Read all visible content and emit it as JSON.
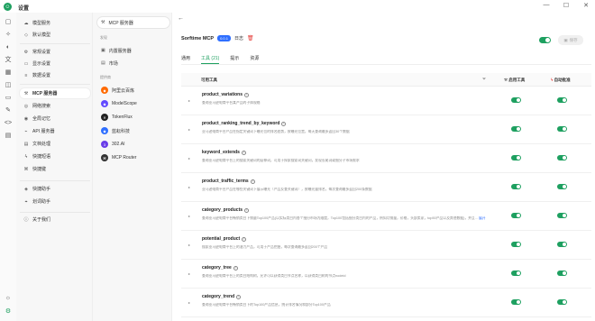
{
  "window": {
    "title": "设置",
    "logo": "☺"
  },
  "nav": {
    "items": [
      {
        "label": "模型服务",
        "icon": "cloud-icon"
      },
      {
        "label": "默认模型",
        "icon": "cube-icon"
      },
      {
        "label": "常规设置",
        "icon": "gear-icon"
      },
      {
        "label": "显示设置",
        "icon": "monitor-icon"
      },
      {
        "label": "数据设置",
        "icon": "database-icon"
      },
      {
        "label": "MCP 服务器",
        "icon": "hammer-icon"
      },
      {
        "label": "网络搜索",
        "icon": "globe-icon"
      },
      {
        "label": "全局记忆",
        "icon": "memory-icon"
      },
      {
        "label": "API 服务器",
        "icon": "api-icon"
      },
      {
        "label": "文档处理",
        "icon": "doc-icon"
      },
      {
        "label": "快捷短语",
        "icon": "zap-icon"
      },
      {
        "label": "快捷键",
        "icon": "command-icon"
      },
      {
        "label": "快捷助手",
        "icon": "assistant-icon"
      },
      {
        "label": "划词助手",
        "icon": "cursor-icon"
      },
      {
        "label": "关于我们",
        "icon": "info-icon"
      }
    ]
  },
  "servers": {
    "active_label": "MCP 服务器",
    "section_builtin": "发现",
    "builtin": [
      {
        "label": "内置服务器"
      },
      {
        "label": "市场"
      }
    ],
    "section_providers": "提供商",
    "providers": [
      {
        "label": "阿里云百炼",
        "color": "#ff6a00",
        "icon": "bailian-icon"
      },
      {
        "label": "ModelScope",
        "color": "#624aff",
        "icon": "modelscope-icon"
      },
      {
        "label": "TokenFlux",
        "color": "#222222",
        "icon": "tokenflux-icon"
      },
      {
        "label": "蓝耘科技",
        "color": "#2f6fff",
        "icon": "lanyun-icon"
      },
      {
        "label": "302.AI",
        "color": "#6a3de8",
        "icon": "302ai-icon"
      },
      {
        "label": "MCP Router",
        "color": "#333333",
        "icon": "mcprouter-icon"
      }
    ]
  },
  "main": {
    "server_name": "Sorftime MCP",
    "version": "0.0.1",
    "log_label": "日志",
    "save_label": "保存",
    "tabs": [
      "通用",
      "工具 (21)",
      "提示",
      "资源"
    ],
    "active_tab": 1,
    "table": {
      "col_tool": "可用工具",
      "col_enable": "启用工具",
      "col_auto": "自动批准"
    },
    "tools": [
      {
        "name": "product_variations",
        "desc": "查询亚马逊电商平台某产品的子体规格"
      },
      {
        "name": "product_ranking_trend_by_keyword",
        "desc": "亚马逊电商平台产品在指定关键词下曝光位的排名趋势，按曝光位置，每天查询最多返回30个数据"
      },
      {
        "name": "keyword_extends",
        "desc": "查询亚马逊电商平台上的搜索关键词的延伸词，可用于探索搜索词关键词，发现长尾词或细分子市场需求"
      },
      {
        "name": "product_traffic_terms",
        "desc": "亚马逊电商平台产品在哪些关键词下展示曝光（产品反查关键词），按曝光量排名，每次查询最多返回200条数据"
      },
      {
        "name": "category_products",
        "desc": "查询亚马逊电商平台畅销类目下销量Top100产品(以实际类目内各个细分市场为维度，Top100包括细分类目内的产品，例如月销量，价格，头部卖家，top50产品以及其他数据)，并且...",
        "more": "展开"
      },
      {
        "name": "potential_product",
        "desc": "搜索亚马逊电商平台上的潜力产品，可用于产品挖掘，每次查询最多返回200个产品"
      },
      {
        "name": "category_tree",
        "desc": "查询亚马逊电商平台上的类目结构树，允许可以获得类目节点名称，以获得类目树的节点nodeid"
      },
      {
        "name": "category_trend",
        "desc": "查询亚马逊电商平台畅销类目下的Top100产品信息，统计排名情况和部分Top100产品"
      }
    ]
  }
}
